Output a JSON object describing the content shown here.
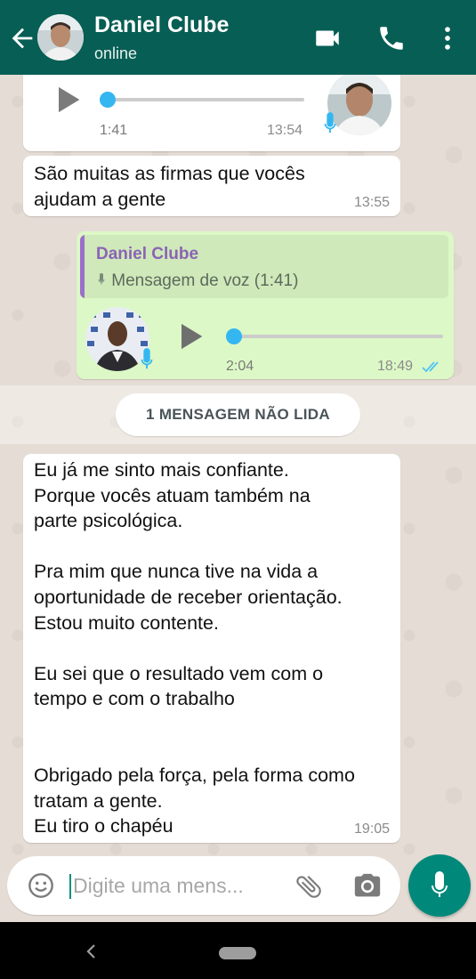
{
  "header": {
    "contact_name": "Daniel Clube",
    "status": "online",
    "icons": [
      "back-arrow-icon",
      "video-call-icon",
      "voice-call-icon",
      "more-vert-icon"
    ],
    "color": "#075e54"
  },
  "messages": [
    {
      "type": "voice",
      "direction": "incoming",
      "duration": "1:41",
      "time": "13:54",
      "progress": 0
    },
    {
      "type": "text",
      "direction": "incoming",
      "text": "São muitas as firmas que vocês\najudam a gente",
      "time": "13:55"
    },
    {
      "type": "voice_reply",
      "direction": "outgoing",
      "quote": {
        "name": "Daniel Clube",
        "text": "Mensagem de voz (1:41)"
      },
      "duration": "2:04",
      "time": "18:49",
      "status": "read",
      "progress": 0
    },
    {
      "type": "text",
      "direction": "incoming",
      "text": "Eu já me sinto mais confiante.\nPorque vocês atuam também na\nparte psicológica.\n\nPra mim que nunca tive na vida a\noportunidade de receber orientação.\nEstou muito contente.\n\nEu sei que o resultado vem com o\ntempo e com o trabalho\n\n\nObrigado pela força, pela forma como\ntratam a gente.\nEu tiro o chapéu",
      "time": "19:05"
    }
  ],
  "unread_label": "1 MENSAGEM NÃO LIDA",
  "input": {
    "placeholder": "Digite uma mens...",
    "value": ""
  },
  "colors": {
    "outgoing_bubble": "#dcf8c6",
    "incoming_bubble": "#ffffff",
    "accent": "#34b7f1",
    "fab": "#00897b"
  }
}
